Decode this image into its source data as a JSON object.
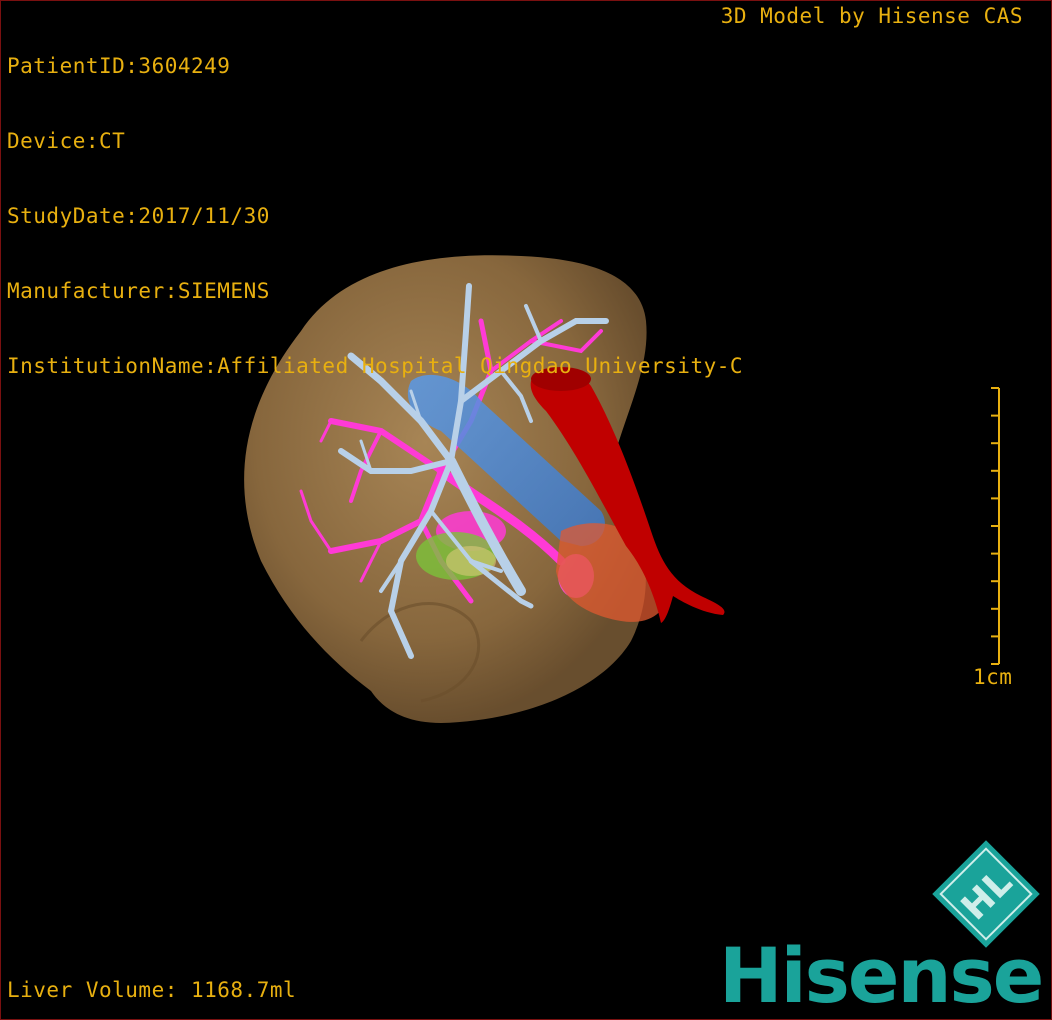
{
  "study_info": {
    "patient_id": "PatientID:3604249",
    "device": "Device:CT",
    "study_date": "StudyDate:2017/11/30",
    "manufacturer": "Manufacturer:SIEMENS",
    "institution": "InstitutionName:Affiliated Hospital Qingdao University-C"
  },
  "model_credit": "3D Model by Hisense CAS",
  "liver_volume": "Liver Volume: 1168.7ml",
  "scale_bar": {
    "label": "1cm",
    "tick_count": 10,
    "color": "#e8b010"
  },
  "logo": {
    "text": "Hisense",
    "mark_letters": "HL",
    "color": "#1aa39a"
  },
  "model_colors": {
    "liver_parenchyma": "#9c7a4c",
    "portal_vein": "#b8d0e8",
    "hepatic_artery": "#ff3ad6",
    "inferior_vena_cava": "#4a8fe0",
    "aorta": "#c00000",
    "gallbladder": "#7cc23a",
    "tumor": "#e05a30"
  }
}
